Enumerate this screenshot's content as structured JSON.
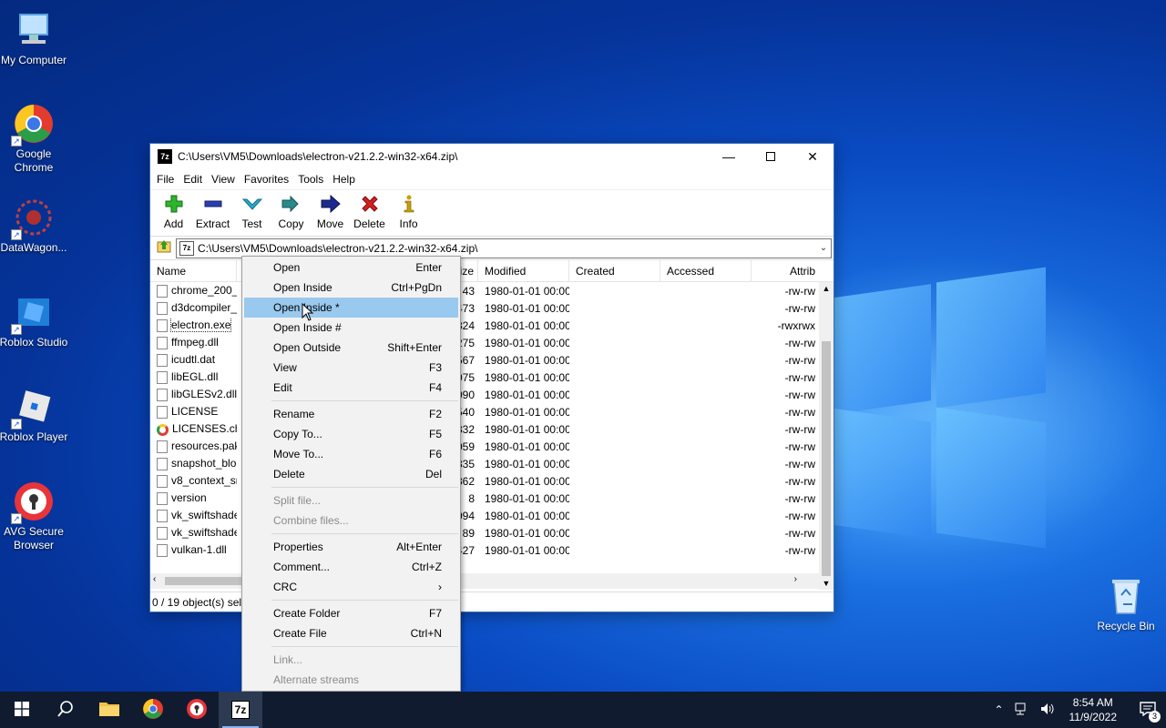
{
  "desktop": {
    "icons": [
      {
        "label": "My Computer"
      },
      {
        "label": "Google Chrome"
      },
      {
        "label": "DataWagon..."
      },
      {
        "label": "Roblox Studio"
      },
      {
        "label": "Roblox Player"
      },
      {
        "label": "AVG Secure Browser"
      },
      {
        "label": "Recycle Bin"
      }
    ]
  },
  "window": {
    "title": "C:\\Users\\VM5\\Downloads\\electron-v21.2.2-win32-x64.zip\\",
    "app_icon_text": "7z",
    "menu": [
      "File",
      "Edit",
      "View",
      "Favorites",
      "Tools",
      "Help"
    ],
    "toolbar": [
      {
        "label": "Add",
        "icon": "plus-icon",
        "color": "#2db52d"
      },
      {
        "label": "Extract",
        "icon": "minus-icon",
        "color": "#2a3fb0"
      },
      {
        "label": "Test",
        "icon": "check-icon",
        "color": "#2aa8c8"
      },
      {
        "label": "Copy",
        "icon": "double-arrow-icon",
        "color": "#2a8a8a"
      },
      {
        "label": "Move",
        "icon": "arrow-right-icon",
        "color": "#1c2a90"
      },
      {
        "label": "Delete",
        "icon": "x-icon",
        "color": "#d42020"
      },
      {
        "label": "Info",
        "icon": "info-icon",
        "color": "#c8a000"
      }
    ],
    "address": "C:\\Users\\VM5\\Downloads\\electron-v21.2.2-win32-x64.zip\\",
    "columns": [
      "Name",
      "ize",
      "Modified",
      "Created",
      "Accessed",
      "Attrib"
    ],
    "files": [
      {
        "name": "chrome_200_p",
        "size": "43",
        "modified": "1980-01-01 00:00",
        "attrib": "-rw-rw"
      },
      {
        "name": "d3dcompiler_4",
        "size": "473",
        "modified": "1980-01-01 00:00",
        "attrib": "-rw-rw"
      },
      {
        "name": "electron.exe",
        "size": "324",
        "modified": "1980-01-01 00:00",
        "attrib": "-rwxrwx"
      },
      {
        "name": "ffmpeg.dll",
        "size": "275",
        "modified": "1980-01-01 00:00",
        "attrib": "-rw-rw"
      },
      {
        "name": "icudtl.dat",
        "size": "567",
        "modified": "1980-01-01 00:00",
        "attrib": "-rw-rw"
      },
      {
        "name": "libEGL.dll",
        "size": "075",
        "modified": "1980-01-01 00:00",
        "attrib": "-rw-rw"
      },
      {
        "name": "libGLESv2.dll",
        "size": "090",
        "modified": "1980-01-01 00:00",
        "attrib": "-rw-rw"
      },
      {
        "name": "LICENSE",
        "size": "540",
        "modified": "1980-01-01 00:00",
        "attrib": "-rw-rw"
      },
      {
        "name": "LICENSES.chro",
        "size": "332",
        "modified": "1980-01-01 00:00",
        "attrib": "-rw-rw"
      },
      {
        "name": "resources.pak",
        "size": "059",
        "modified": "1980-01-01 00:00",
        "attrib": "-rw-rw"
      },
      {
        "name": "snapshot_blob",
        "size": "335",
        "modified": "1980-01-01 00:00",
        "attrib": "-rw-rw"
      },
      {
        "name": "v8_context_sna",
        "size": "362",
        "modified": "1980-01-01 00:00",
        "attrib": "-rw-rw"
      },
      {
        "name": "version",
        "size": "8",
        "modified": "1980-01-01 00:00",
        "attrib": "-rw-rw"
      },
      {
        "name": "vk_swiftshader",
        "size": "094",
        "modified": "1980-01-01 00:00",
        "attrib": "-rw-rw"
      },
      {
        "name": "vk_swiftshader",
        "size": "89",
        "modified": "1980-01-01 00:00",
        "attrib": "-rw-rw"
      },
      {
        "name": "vulkan-1.dll",
        "size": "427",
        "modified": "1980-01-01 00:00",
        "attrib": "-rw-rw"
      }
    ],
    "status": "0 / 19 object(s) sele"
  },
  "context_menu": {
    "items": [
      {
        "label": "Open",
        "shortcut": "Enter"
      },
      {
        "label": "Open Inside",
        "shortcut": "Ctrl+PgDn"
      },
      {
        "label": "Open Inside *",
        "shortcut": "",
        "highlighted": true
      },
      {
        "label": "Open Inside #",
        "shortcut": ""
      },
      {
        "label": "Open Outside",
        "shortcut": "Shift+Enter"
      },
      {
        "label": "View",
        "shortcut": "F3"
      },
      {
        "label": "Edit",
        "shortcut": "F4"
      },
      {
        "sep": true
      },
      {
        "label": "Rename",
        "shortcut": "F2"
      },
      {
        "label": "Copy To...",
        "shortcut": "F5"
      },
      {
        "label": "Move To...",
        "shortcut": "F6"
      },
      {
        "label": "Delete",
        "shortcut": "Del"
      },
      {
        "sep": true
      },
      {
        "label": "Split file...",
        "shortcut": "",
        "disabled": true
      },
      {
        "label": "Combine files...",
        "shortcut": "",
        "disabled": true
      },
      {
        "sep": true
      },
      {
        "label": "Properties",
        "shortcut": "Alt+Enter"
      },
      {
        "label": "Comment...",
        "shortcut": "Ctrl+Z"
      },
      {
        "label": "CRC",
        "shortcut": "›"
      },
      {
        "sep": true
      },
      {
        "label": "Create Folder",
        "shortcut": "F7"
      },
      {
        "label": "Create File",
        "shortcut": "Ctrl+N"
      },
      {
        "sep": true
      },
      {
        "label": "Link...",
        "shortcut": "",
        "disabled": true
      },
      {
        "label": "Alternate streams",
        "shortcut": "",
        "disabled": true
      }
    ]
  },
  "taskbar": {
    "time": "8:54 AM",
    "date": "11/9/2022",
    "notifications": "3",
    "active_app_label": "7z"
  }
}
